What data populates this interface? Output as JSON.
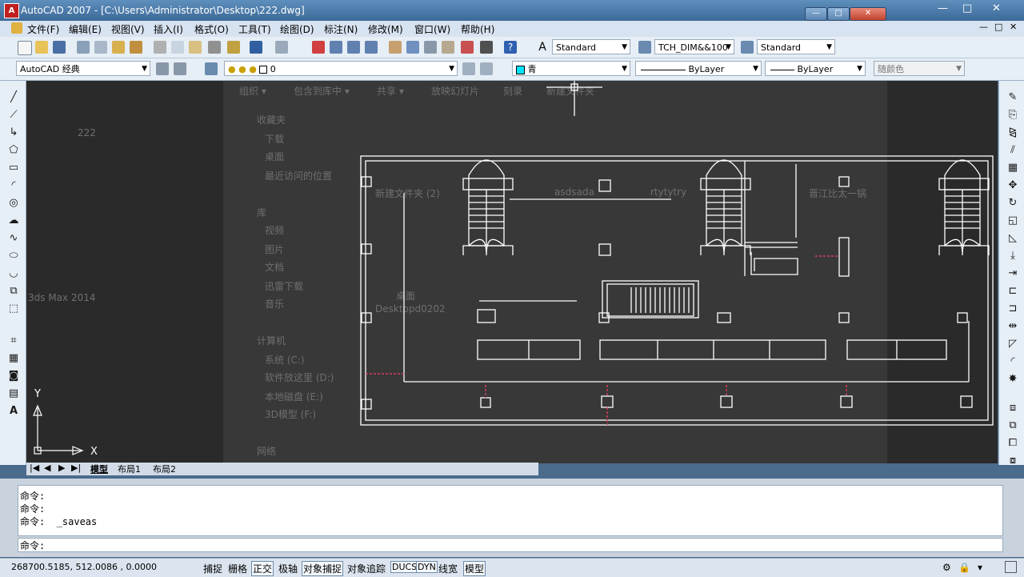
{
  "window": {
    "title": "AutoCAD 2007 - [C:\\Users\\Administrator\\Desktop\\222.dwg]",
    "app_icon_letter": "A",
    "controls": [
      "—",
      "□",
      "✕"
    ]
  },
  "menu": [
    "文件(F)",
    "编辑(E)",
    "视图(V)",
    "插入(I)",
    "格式(O)",
    "工具(T)",
    "绘图(D)",
    "标注(N)",
    "修改(M)",
    "窗口(W)",
    "帮助(H)"
  ],
  "toolbar1": {
    "text_style": "Standard",
    "dim_style": "TCH_DIM&&100",
    "table_style": "Standard"
  },
  "toolbar2": {
    "workspace": "AutoCAD 经典",
    "layer_name": "0",
    "color": "青",
    "linetype": "ByLayer",
    "lineweight": "ByLayer",
    "plotstyle": "随颜色"
  },
  "ucs": {
    "x_label": "X",
    "y_label": "Y"
  },
  "layout_tabs": [
    "模型",
    "布局1",
    "布局2"
  ],
  "command_history": [
    "命令:",
    "命令:",
    "命令:  _saveas"
  ],
  "command_prompt": "命令:",
  "status": {
    "coords": "268700.5185, 512.0086  , 0.0000",
    "buttons": [
      "捕捉",
      "栅格",
      "正交",
      "极轴",
      "对象捕捉",
      "对象追踪",
      "DUCS",
      "DYN",
      "线宽",
      "模型"
    ],
    "active": [
      "正交",
      "对象捕捉",
      "DUCS",
      "DYN",
      "模型"
    ]
  },
  "overlay_explorer": {
    "toolbar": [
      "组织 ▾",
      "包含到库中 ▾",
      "共享 ▾",
      "放映幻灯片",
      "刻录",
      "新建文件夹"
    ],
    "nav_items": [
      "收藏夹",
      "下载",
      "桌面",
      "最近访问的位置",
      "库",
      "视频",
      "图片",
      "文档",
      "迅雷下载",
      "音乐",
      "计算机",
      "系统 (C:)",
      "软件放这里 (D:)",
      "本地磁盘 (E:)",
      "3D模型 (F:)",
      "网络"
    ],
    "files": [
      "新建文件夹 (2)",
      "asdsada",
      "rtytytry",
      "晋江比太一锅",
      "桌面",
      "Desktopd0202"
    ],
    "desktop_icons": [
      "222",
      "3ds Max 2014"
    ]
  },
  "colors": {
    "drawing_bg": "#2a2a2a",
    "cad_lines": "#ffffff",
    "hidden_red": "#d04060",
    "color_swatch_cyan": "#00e5ff",
    "titlebar": "#4a7aa8"
  }
}
